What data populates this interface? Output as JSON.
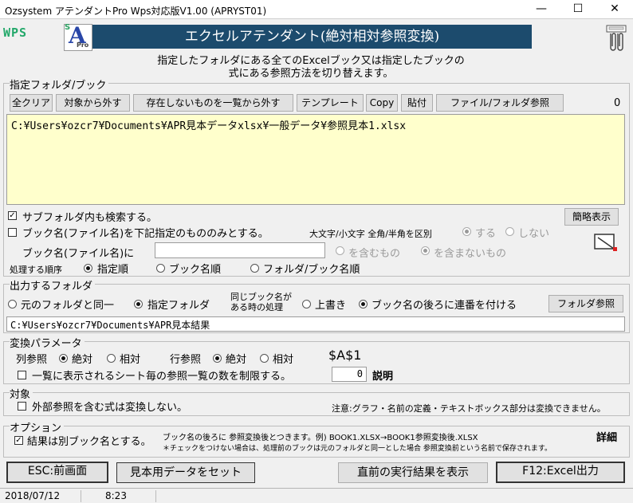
{
  "window": {
    "title": "Ozsystem アテンダントPro Wps対応版V1.00 (APRYST01)",
    "minimize": "—",
    "maximize": "☐",
    "close": "✕"
  },
  "header": {
    "wps_logo": "WPS",
    "logo_s": "S",
    "logo_a": "A",
    "logo_pro": "Pro",
    "banner": "エクセルアテンダント(絶対相対参照変換)",
    "desc_line1": "指定したフォルダにある全てのExcelブック又は指定したブックの",
    "desc_line2": "式にある参照方法を切り替えます。"
  },
  "folder_group": {
    "label": "指定フォルダ/ブック",
    "buttons": [
      "全クリア",
      "対象から外す",
      "存在しないものを一覧から外す",
      "テンプレート",
      "Copy",
      "貼付",
      "ファイル/フォルダ参照"
    ],
    "count": "0",
    "list_text": "C:¥Users¥ozcr7¥Documents¥APR見本データxlsx¥一般データ¥参照見本1.xlsx",
    "subfolder_label": "サブフォルダ内も検索する。",
    "simple_view": "簡略表示",
    "bookname_only_label": "ブック名(ファイル名)を下記指定のもののみとする。",
    "case_label": "大文字/小文字 全角/半角を区別",
    "case_yes": "する",
    "case_no": "しない",
    "bookname_label": "ブック名(ファイル名)に",
    "bookname_value": "",
    "contains": "を含むもの",
    "not_contains": "を含まないもの",
    "order_label": "処理する順序",
    "order_options": [
      "指定順",
      "ブック名順",
      "フォルダ/ブック名順"
    ]
  },
  "output_group": {
    "label": "出力するフォルダ",
    "same_folder": "元のフォルダと同一",
    "specified_folder": "指定フォルダ",
    "same_name_line1": "同じブック名が",
    "same_name_line2": "ある時の処理",
    "overwrite": "上書き",
    "append_serial": "ブック名の後ろに連番を付ける",
    "folder_ref": "フォルダ参照",
    "path": "C:¥Users¥ozcr7¥Documents¥APR見本結果"
  },
  "params_group": {
    "label": "変換パラメータ",
    "col_ref": "列参照",
    "row_ref": "行参照",
    "absolute": "絶対",
    "relative": "相対",
    "preview": "$A$1",
    "limit_label": "一覧に表示されるシート毎の参照一覧の数を制限する。",
    "limit_value": "0",
    "explain": "説明"
  },
  "target_group": {
    "label": "対象",
    "external_label": "外部参照を含む式は変換しない。",
    "note": "注意:グラフ・名前の定義・テキストボックス部分は変換できません。"
  },
  "option_group": {
    "label": "オプション",
    "separate_book_label": "結果は別ブック名とする。",
    "info_line1": "ブック名の後ろに 参照変換後とつきます。例) BOOK1.XLSX→BOOK1参照変換後.XLSX",
    "info_line2": "＊チェックをつけない場合は、処理前のブックは元のフォルダと同一とした場合 参照変換前という名前で保存されます。",
    "detail": "詳細"
  },
  "footer": {
    "esc_button": "ESC:前画面",
    "sample_button": "見本用データをセット",
    "last_result_button": "直前の実行結果を表示",
    "f12_button": "F12:Excel出力"
  },
  "status": {
    "date": "2018/07/12",
    "time": "8:23"
  }
}
